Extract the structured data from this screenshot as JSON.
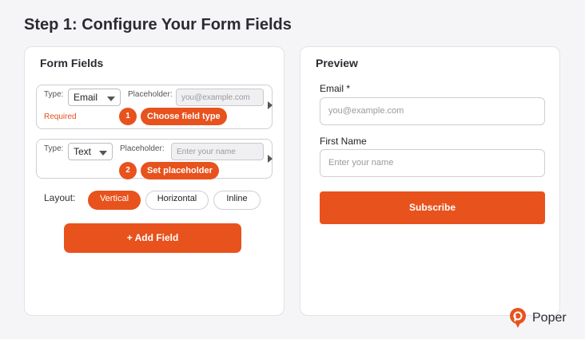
{
  "page": {
    "title": "Step 1: Configure Your Form Fields"
  },
  "form_fields": {
    "title": "Form Fields",
    "fields": [
      {
        "type_label": "Type:",
        "type_value": "Email",
        "placeholder_label": "Placeholder:",
        "placeholder_value": "you@example.com",
        "required_text": "Required",
        "step_number": "1",
        "step_text": "Choose field type"
      },
      {
        "type_label": "Type:",
        "type_value": "Text",
        "placeholder_label": "Placeholder:",
        "placeholder_value": "Enter your name",
        "step_number": "2",
        "step_text": "Set placeholder"
      }
    ],
    "layout": {
      "label": "Layout:",
      "options": [
        "Vertical",
        "Horizontal",
        "Inline"
      ],
      "selected": "Vertical"
    },
    "add_button": "+ Add Field"
  },
  "preview": {
    "title": "Preview",
    "fields": [
      {
        "label": "Email *",
        "placeholder": "you@example.com"
      },
      {
        "label": "First Name",
        "placeholder": "Enter your name"
      }
    ],
    "submit_label": "Subscribe"
  },
  "brand": {
    "name": "Poper",
    "color": "#e8521d"
  },
  "colors": {
    "accent": "#e8521d",
    "required": "#e0531f"
  }
}
